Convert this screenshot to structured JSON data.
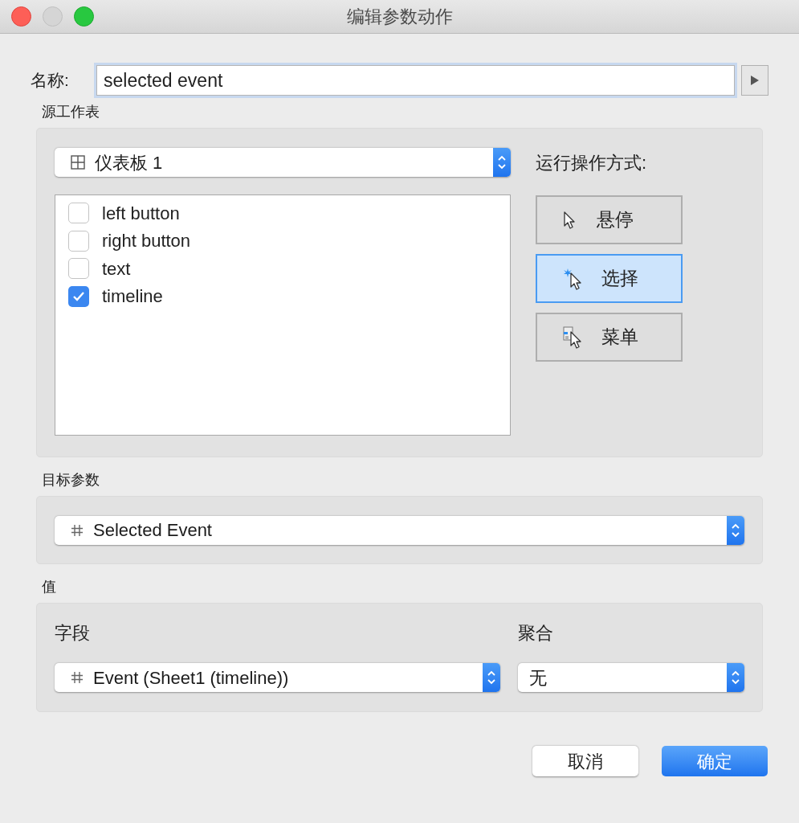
{
  "window": {
    "title": "编辑参数动作"
  },
  "name": {
    "label": "名称:",
    "value": "selected event"
  },
  "source_sheet": {
    "label": "源工作表",
    "dropdown": "仪表板 1",
    "sheets": [
      {
        "label": "left button",
        "checked": false
      },
      {
        "label": "right button",
        "checked": false
      },
      {
        "label": "text",
        "checked": false
      },
      {
        "label": "timeline",
        "checked": true
      }
    ],
    "run_label": "运行操作方式:",
    "run_modes": [
      {
        "kind": "hover",
        "label": "悬停",
        "selected": false
      },
      {
        "kind": "select",
        "label": "选择",
        "selected": true
      },
      {
        "kind": "menu",
        "label": "菜单",
        "selected": false
      }
    ]
  },
  "target_parameter": {
    "label": "目标参数",
    "dropdown": "Selected Event"
  },
  "value": {
    "label": "值",
    "field_label": "字段",
    "field": "Event (Sheet1 (timeline))",
    "aggregation_label": "聚合",
    "aggregation": "无"
  },
  "buttons": {
    "cancel": "取消",
    "ok": "确定"
  }
}
